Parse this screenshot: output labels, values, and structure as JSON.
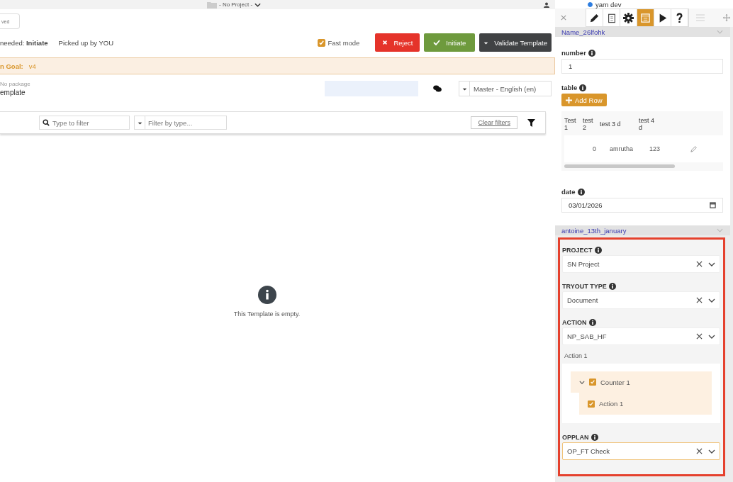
{
  "top_bar": {
    "project_selector": "- No Project -",
    "environment": {
      "label": "yarn dev",
      "selected": true
    }
  },
  "header": {
    "field_placeholder": "ved",
    "status": "needed: **Initiate**",
    "picked_up": "Picked up by YOU",
    "fast_mode": {
      "label": "Fast mode",
      "checked": true
    },
    "buttons": [
      {
        "label": "Reject",
        "kind": "reject"
      },
      {
        "label": "Initiate",
        "kind": "initiate"
      },
      {
        "label": "Validate Template",
        "kind": "validate"
      }
    ]
  },
  "goal": {
    "label": "n Goal:",
    "value": "v4"
  },
  "template": {
    "package": "No package",
    "name": "emplate",
    "language": "Master - English (en)"
  },
  "filters": {
    "search_placeholder": "Type to filter",
    "type_placeholder": "Filter by type...",
    "clear": "Clear filters"
  },
  "empty_message": "This Template is empty.",
  "panel": {
    "toolbar": [
      {
        "kind": "pencil",
        "selected": false
      },
      {
        "kind": "clipboard",
        "selected": false
      },
      {
        "kind": "gear",
        "selected": false
      },
      {
        "kind": "calendar",
        "selected": true
      },
      {
        "kind": "play",
        "selected": false
      },
      {
        "kind": "help",
        "selected": false
      }
    ],
    "sections": [
      {
        "title": "Name_26lfohk",
        "highlighted": false,
        "fields": [
          {
            "kind": "text",
            "label": "number",
            "value": "1"
          },
          {
            "kind": "table",
            "label": "table",
            "button": "Add Row",
            "columns": [
              "Test 1",
              "test 2",
              "test 3 d",
              "test 4 d"
            ],
            "rows": [
              {
                "cells": [
                  "0",
                  "amrutha",
                  "123"
                ]
              }
            ]
          },
          {
            "kind": "date",
            "label": "date",
            "value": "03/01/2026"
          }
        ]
      },
      {
        "title": "antoine_13th_january",
        "highlighted": true,
        "fields": [
          {
            "kind": "select",
            "label": "PROJECT",
            "value": "SN Project",
            "focused": false
          },
          {
            "kind": "select",
            "label": "TRYOUT TYPE",
            "value": "Document",
            "focused": false
          },
          {
            "kind": "select",
            "label": "ACTION",
            "value": "NP_SAB_HF",
            "focused": false
          },
          {
            "kind": "tree",
            "label": "Action 1",
            "items": [
              {
                "label": "Counter 1",
                "checked": true,
                "expanded": true,
                "children": [
                  {
                    "label": "Action 1",
                    "checked": true
                  }
                ]
              }
            ]
          },
          {
            "kind": "select",
            "label": "OPPLAN",
            "value": "OP_FT Check",
            "focused": true
          }
        ]
      }
    ]
  }
}
